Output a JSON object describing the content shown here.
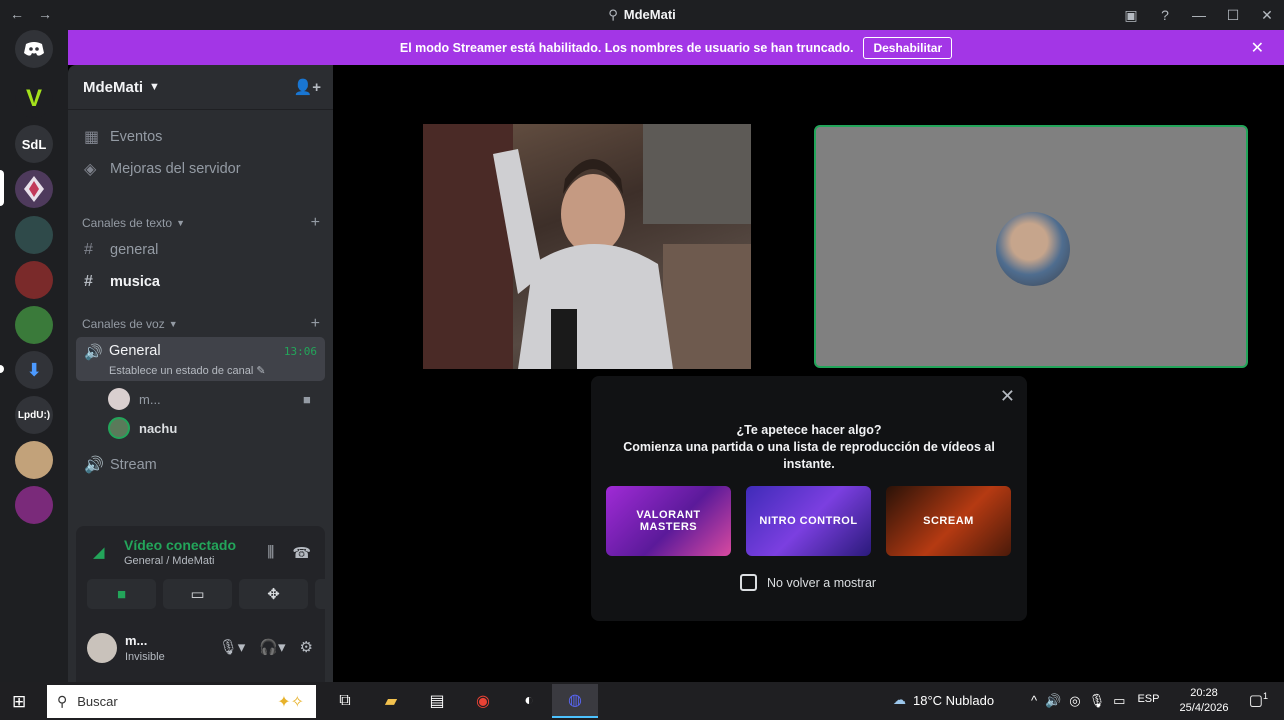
{
  "titlebar": {
    "title": "MdeMati",
    "back": "←",
    "forward": "→"
  },
  "banner": {
    "text": "El modo Streamer está habilitado. Los nombres de usuario se han truncado.",
    "button": "Deshabilitar",
    "close": "✕"
  },
  "guilds": [
    {
      "label": "",
      "color": "#313338",
      "icon": "discord-home-icon"
    },
    {
      "label": "V",
      "color": "#1e1f22"
    },
    {
      "label": "SdL",
      "color": "#313338"
    },
    {
      "label": "",
      "color": "#4e3a5c"
    },
    {
      "label": "",
      "color": "#2f4a4a"
    },
    {
      "label": "",
      "color": "#7a2a2a"
    },
    {
      "label": "",
      "color": "#3a7a3a"
    },
    {
      "label": "⬇",
      "color": "#313338"
    },
    {
      "label": "LpdU:)",
      "color": "#313338"
    },
    {
      "label": "",
      "color": "#c2a27a"
    },
    {
      "label": "",
      "color": "#7a2a7a"
    }
  ],
  "server": {
    "name": "MdeMati",
    "events": "Eventos",
    "boosts": "Mejoras del servidor",
    "text_category": "Canales de texto",
    "text_channels": [
      "general",
      "musica"
    ],
    "voice_category": "Canales de voz",
    "voice_channel": {
      "name": "General",
      "time": "13:06",
      "status": "Establece un estado de canal"
    },
    "members": [
      {
        "name": "m...",
        "color": "#d9cfcf"
      },
      {
        "name": "nachu",
        "color": "#5a7a5a"
      }
    ],
    "stream_channel": "Stream"
  },
  "rtc": {
    "title": "Vídeo conectado",
    "subtitle": "General / MdeMati"
  },
  "user": {
    "name": "m...",
    "status": "Invisible"
  },
  "modal": {
    "question": "¿Te apetece hacer algo?",
    "body": "Comienza una partida o una lista de reproducción de vídeos al instante.",
    "cards": [
      {
        "label": "VALORANT MASTERS"
      },
      {
        "label": "NITRO CONTROL"
      },
      {
        "label": "SCREAM"
      }
    ],
    "checkbox": "No volver a mostrar"
  },
  "taskbar": {
    "search_placeholder": "Buscar",
    "weather": "18°C  Nublado",
    "lang": "ESP",
    "time": "20:28",
    "date": "25/4/2026",
    "notif_count": "1"
  }
}
